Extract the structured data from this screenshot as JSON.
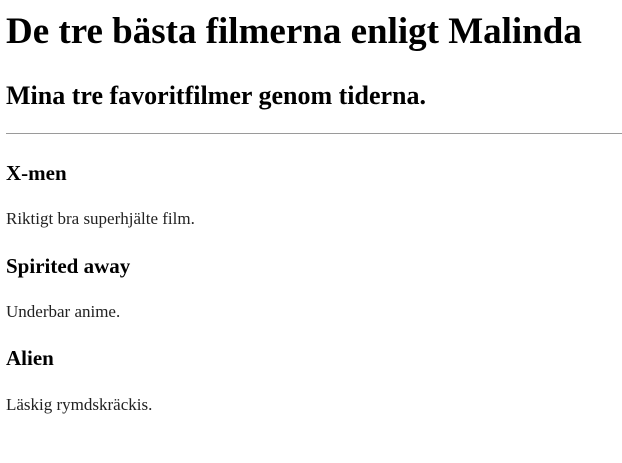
{
  "page": {
    "heading": "De tre bästa filmerna enligt Malinda",
    "subheading": "Mina tre favoritfilmer genom tiderna."
  },
  "movies": [
    {
      "title": "X-men",
      "description": "Riktigt bra superhjälte film."
    },
    {
      "title": "Spirited away",
      "description": "Underbar anime."
    },
    {
      "title": "Alien",
      "description": "Läskig rymdskräckis."
    }
  ]
}
